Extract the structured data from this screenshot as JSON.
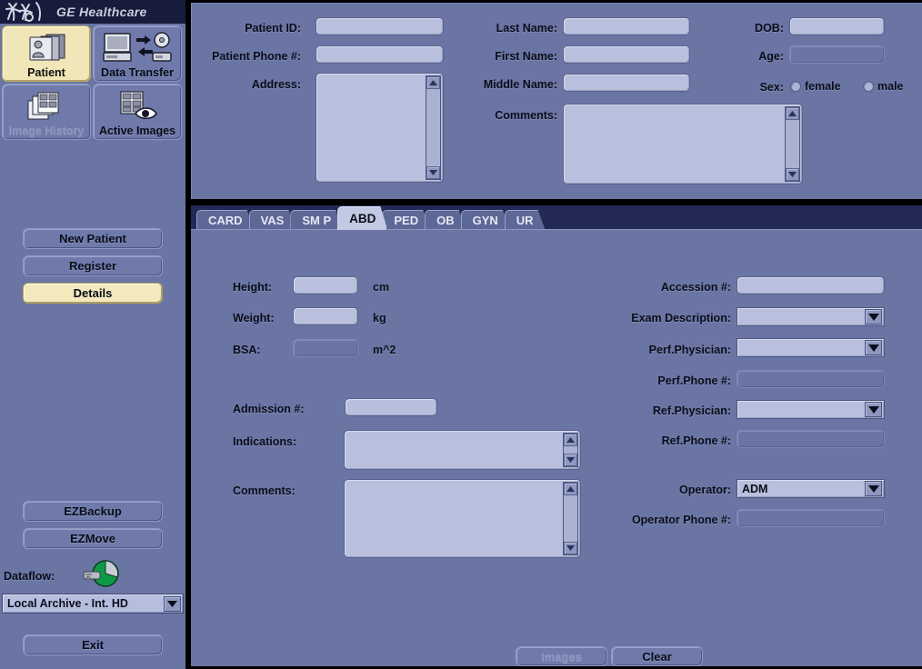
{
  "brand": {
    "name": "GE Healthcare",
    "logo_icon": "ge-monogram-icon"
  },
  "nav_tiles": [
    {
      "label": "Patient",
      "icon": "patient-folder-icon",
      "state": "selected"
    },
    {
      "label": "Data Transfer",
      "icon": "data-transfer-icon",
      "state": "enabled"
    },
    {
      "label": "Image History",
      "icon": "image-history-icon",
      "state": "disabled"
    },
    {
      "label": "Active Images",
      "icon": "active-images-eye-icon",
      "state": "enabled"
    }
  ],
  "sidebar": {
    "buttons": [
      {
        "label": "New Patient",
        "state": "enabled"
      },
      {
        "label": "Register",
        "state": "enabled"
      },
      {
        "label": "Details",
        "state": "active"
      }
    ],
    "utility_buttons": [
      {
        "label": "EZBackup",
        "state": "enabled"
      },
      {
        "label": "EZMove",
        "state": "enabled"
      }
    ],
    "dataflow": {
      "label": "Dataflow:",
      "icon": "dataflow-pie-disk-icon",
      "selected": "Local Archive - Int. HD",
      "dropdown_icon": "chevron-down-icon"
    },
    "exit_button": {
      "label": "Exit"
    }
  },
  "demographics": {
    "patient_id": {
      "label": "Patient ID:",
      "value": "",
      "placeholder": ""
    },
    "patient_phone": {
      "label": "Patient Phone #:",
      "value": "",
      "placeholder": ""
    },
    "address": {
      "label": "Address:",
      "value": "",
      "scrollbar": true
    },
    "last_name": {
      "label": "Last Name:",
      "value": "",
      "placeholder": ""
    },
    "first_name": {
      "label": "First Name:",
      "value": "",
      "placeholder": ""
    },
    "middle_name": {
      "label": "Middle Name:",
      "value": "",
      "placeholder": ""
    },
    "comments": {
      "label": "Comments:",
      "value": "",
      "scrollbar": true
    },
    "dob": {
      "label": "DOB:",
      "value": "",
      "placeholder": ""
    },
    "age": {
      "label": "Age:",
      "value": "",
      "readonly": true
    },
    "sex": {
      "label": "Sex:",
      "options": [
        {
          "label": "female",
          "selected": false
        },
        {
          "label": "male",
          "selected": false
        }
      ]
    }
  },
  "tabs": [
    {
      "label": "CARD",
      "active": false
    },
    {
      "label": "VAS",
      "active": false
    },
    {
      "label": "SM P",
      "active": false
    },
    {
      "label": "ABD",
      "active": true
    },
    {
      "label": "PED",
      "active": false
    },
    {
      "label": "OB",
      "active": false
    },
    {
      "label": "GYN",
      "active": false
    },
    {
      "label": "UR",
      "active": false
    }
  ],
  "exam": {
    "height": {
      "label": "Height:",
      "value": "",
      "unit": "cm"
    },
    "weight": {
      "label": "Weight:",
      "value": "",
      "unit": "kg"
    },
    "bsa": {
      "label": "BSA:",
      "value": "",
      "unit": "m^2",
      "readonly": true
    },
    "admission": {
      "label": "Admission #:",
      "value": ""
    },
    "indications": {
      "label": "Indications:",
      "value": "",
      "scrollbar": true
    },
    "comments": {
      "label": "Comments:",
      "value": "",
      "scrollbar": true
    },
    "accession": {
      "label": "Accession #:",
      "value": ""
    },
    "exam_description": {
      "label": "Exam Description:",
      "value": "",
      "dropdown_icon": "chevron-down-icon"
    },
    "perf_physician": {
      "label": "Perf.Physician:",
      "value": "",
      "dropdown_icon": "chevron-down-icon"
    },
    "perf_phone": {
      "label": "Perf.Phone #:",
      "value": "",
      "readonly": true
    },
    "ref_physician": {
      "label": "Ref.Physician:",
      "value": "",
      "dropdown_icon": "chevron-down-icon"
    },
    "ref_phone": {
      "label": "Ref.Phone #:",
      "value": "",
      "readonly": true
    },
    "operator": {
      "label": "Operator:",
      "value": "ADM",
      "dropdown_icon": "chevron-down-icon"
    },
    "operator_phone": {
      "label": "Operator Phone #:",
      "value": "",
      "readonly": true
    }
  },
  "actions": [
    {
      "label": "Images",
      "state": "disabled"
    },
    {
      "label": "Clear",
      "state": "enabled"
    }
  ],
  "colors": {
    "panel_bg": "#6a75a4",
    "field_bg": "#b8c0de",
    "header_bg": "#171c3c",
    "tabstrip_bg": "#232a57",
    "active_tab_bg": "#c2c9e3",
    "selected_tile_bg": "#f0e6b8",
    "dataflow_green": "#14a04a"
  }
}
